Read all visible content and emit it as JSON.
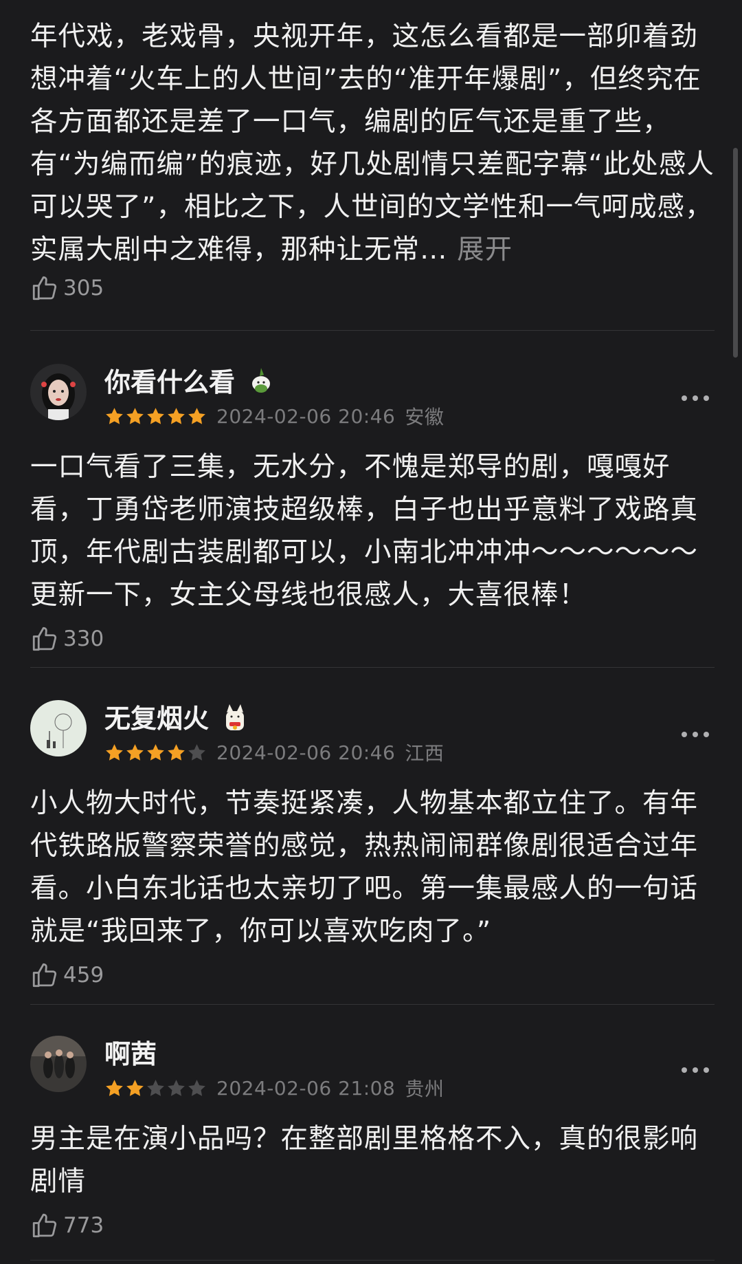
{
  "first_review": {
    "body": "年代戏，老戏骨，央视开年，这怎么看都是一部卯着劲想冲着“火车上的人世间”去的“准开年爆剧”，但终究在各方面都还是差了一口气，编剧的匠气还是重了些，有“为编而编”的痕迹，好几处剧情只差配字幕“此处感人可以哭了”，相比之下，人世间的文学性和一气呵成感，实属大剧中之难得，那种让无常…",
    "expand_label": "展开",
    "likes": "305"
  },
  "reviews": [
    {
      "username": "你看什么看",
      "badge_icon": "rabbit-sticker-icon",
      "rating": 5,
      "date": "2024-02-06 20:46",
      "location": "安徽",
      "body": "一口气看了三集，无水分，不愧是郑导的剧，嘎嘎好看，丁勇岱老师演技超级棒，白子也出乎意料了戏路真顶，年代剧古装剧都可以，小南北冲冲冲～～～～～～更新一下，女主父母线也很感人，大喜很棒！",
      "likes": "330"
    },
    {
      "username": "无复烟火",
      "badge_icon": "lucky-cat-icon",
      "rating": 4,
      "date": "2024-02-06 20:46",
      "location": "江西",
      "body": "小人物大时代，节奏挺紧凑，人物基本都立住了。有年代铁路版警察荣誉的感觉，热热闹闹群像剧很适合过年看。小白东北话也太亲切了吧。第一集最感人的一句话就是“我回来了，你可以喜欢吃肉了。”",
      "likes": "459"
    },
    {
      "username": "啊茜",
      "badge_icon": "",
      "rating": 2,
      "date": "2024-02-06 21:08",
      "location": "贵州",
      "body": "男主是在演小品吗？在整部剧里格格不入，真的很影响剧情",
      "likes": "773"
    }
  ],
  "colors": {
    "background": "#1b1b1d",
    "star_filled": "#f4a024",
    "star_empty": "#4e4e50",
    "divider": "#343436"
  }
}
